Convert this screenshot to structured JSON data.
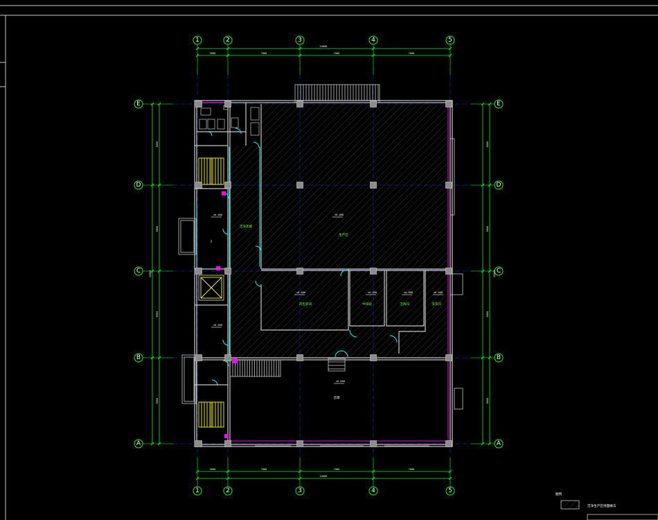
{
  "drawing": {
    "axes_numbered": [
      "1",
      "2",
      "3",
      "4",
      "5"
    ],
    "axes_lettered": [
      "E",
      "D",
      "C",
      "B",
      "A"
    ],
    "dimensions_top": [
      "3000",
      "7000",
      "7000",
      "7000"
    ],
    "dimension_top_total": "24000",
    "dimensions_bottom": [
      "3000",
      "7000",
      "7000",
      "7000"
    ],
    "dimension_bottom_total": "24000",
    "dimensions_left": [
      "8000",
      "8000",
      "8000",
      "8000"
    ],
    "dimension_left_total": "32000",
    "dimensions_right": [
      "8000",
      "8000",
      "8000",
      "8000"
    ],
    "dimension_right_total": "32000",
    "rooms": [
      {
        "name": "purification-corridor",
        "label": "洁净走廊"
      },
      {
        "name": "production-area",
        "label": "生产区"
      },
      {
        "name": "packing-room",
        "label": "内包装间"
      },
      {
        "name": "room-a",
        "label": "中间站"
      },
      {
        "name": "room-b",
        "label": "洁具间"
      },
      {
        "name": "room-c",
        "label": "洗衣间"
      },
      {
        "name": "warehouse",
        "label": "仓库"
      }
    ],
    "elevations": [
      "±0.000",
      "±0.000",
      "±0.000",
      "±0.000",
      "±0.000",
      "±0.000",
      "±0.000",
      "±0.000"
    ],
    "legend": {
      "title": "图例",
      "item": "洁净生产区地面做法"
    }
  },
  "colors": {
    "background": "#000000",
    "wall": "#c8c8c8",
    "axis_green": "#00ff00",
    "door_cyan": "#00ffff",
    "accent_magenta": "#ff00ff",
    "stair_yellow": "#ffff00",
    "grid_blue": "#0000ff",
    "hatch_gray": "#5a5a5a"
  }
}
